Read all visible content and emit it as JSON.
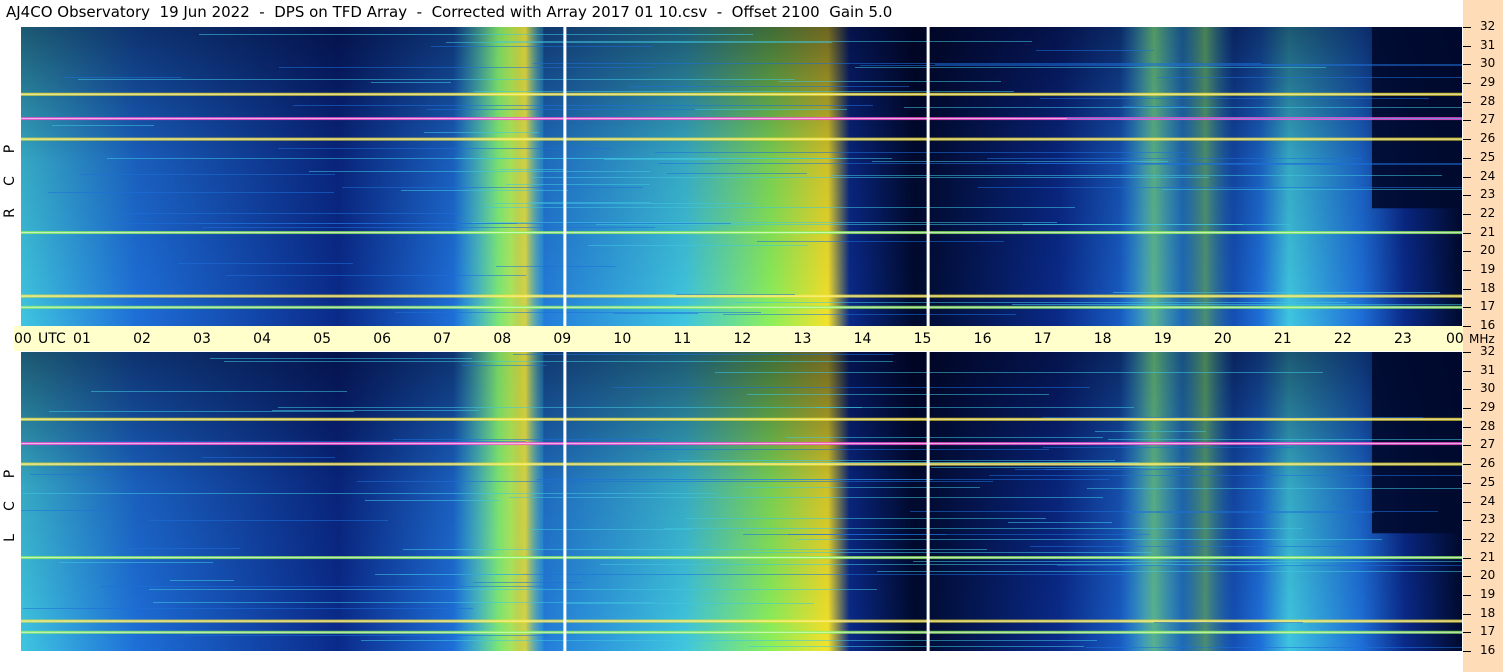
{
  "title": "AJ4CO Observatory  19 Jun 2022  -  DPS on TFD Array  -  Corrected with Array 2017 01 10.csv  -  Offset 2100  Gain 5.0",
  "colors": {
    "background_dark": "#000a2e",
    "deep_blue": "#0a2a8a",
    "mid_blue": "#1e6fd9",
    "cyan": "#3fc6e0",
    "green": "#8cf05a",
    "yellow": "#f5e22a",
    "orange": "#ff9a2a",
    "magenta": "#ff4fd6",
    "axis_bar": "#ffffcc",
    "freq_strip": "#ffdcb8"
  },
  "chart_data": {
    "type": "heatmap",
    "xlabel": "UTC",
    "ylabel": "MHz",
    "x_ticks": [
      "00",
      "01",
      "02",
      "03",
      "04",
      "05",
      "06",
      "07",
      "08",
      "09",
      "10",
      "11",
      "12",
      "13",
      "14",
      "15",
      "16",
      "17",
      "18",
      "19",
      "20",
      "21",
      "22",
      "23",
      "00"
    ],
    "xlim": [
      0,
      24
    ],
    "ylim": [
      16,
      32
    ],
    "y_ticks": [
      "16",
      "17",
      "18",
      "19",
      "20",
      "21",
      "22",
      "23",
      "24",
      "25",
      "26",
      "27",
      "28",
      "29",
      "30",
      "31",
      "32"
    ],
    "panels": [
      {
        "name_chars": [
          "R",
          "C",
          "P"
        ]
      },
      {
        "name_chars": [
          "L",
          "C",
          "P"
        ]
      }
    ],
    "vertical_markers_utc": [
      9.05,
      15.1
    ],
    "broad_bright_band_utc": [
      7.2,
      8.7
    ],
    "secondary_bright_band_utc": [
      18.3,
      20.2
    ],
    "bright_horizontal_bands_mhz": [
      27.1,
      28.4,
      21.0,
      17.6,
      17.0,
      26.0
    ]
  },
  "axis": {
    "time_unit_label": "UTC",
    "freq_unit_label": "MHz",
    "time_labels": [
      "00",
      "01",
      "02",
      "03",
      "04",
      "05",
      "06",
      "07",
      "08",
      "09",
      "10",
      "11",
      "12",
      "13",
      "14",
      "15",
      "16",
      "17",
      "18",
      "19",
      "20",
      "21",
      "22",
      "23"
    ],
    "end_label": "00",
    "freq_labels": [
      "32",
      "31",
      "30",
      "29",
      "28",
      "27",
      "26",
      "25",
      "24",
      "23",
      "22",
      "21",
      "20",
      "19",
      "18",
      "17",
      "16"
    ]
  }
}
